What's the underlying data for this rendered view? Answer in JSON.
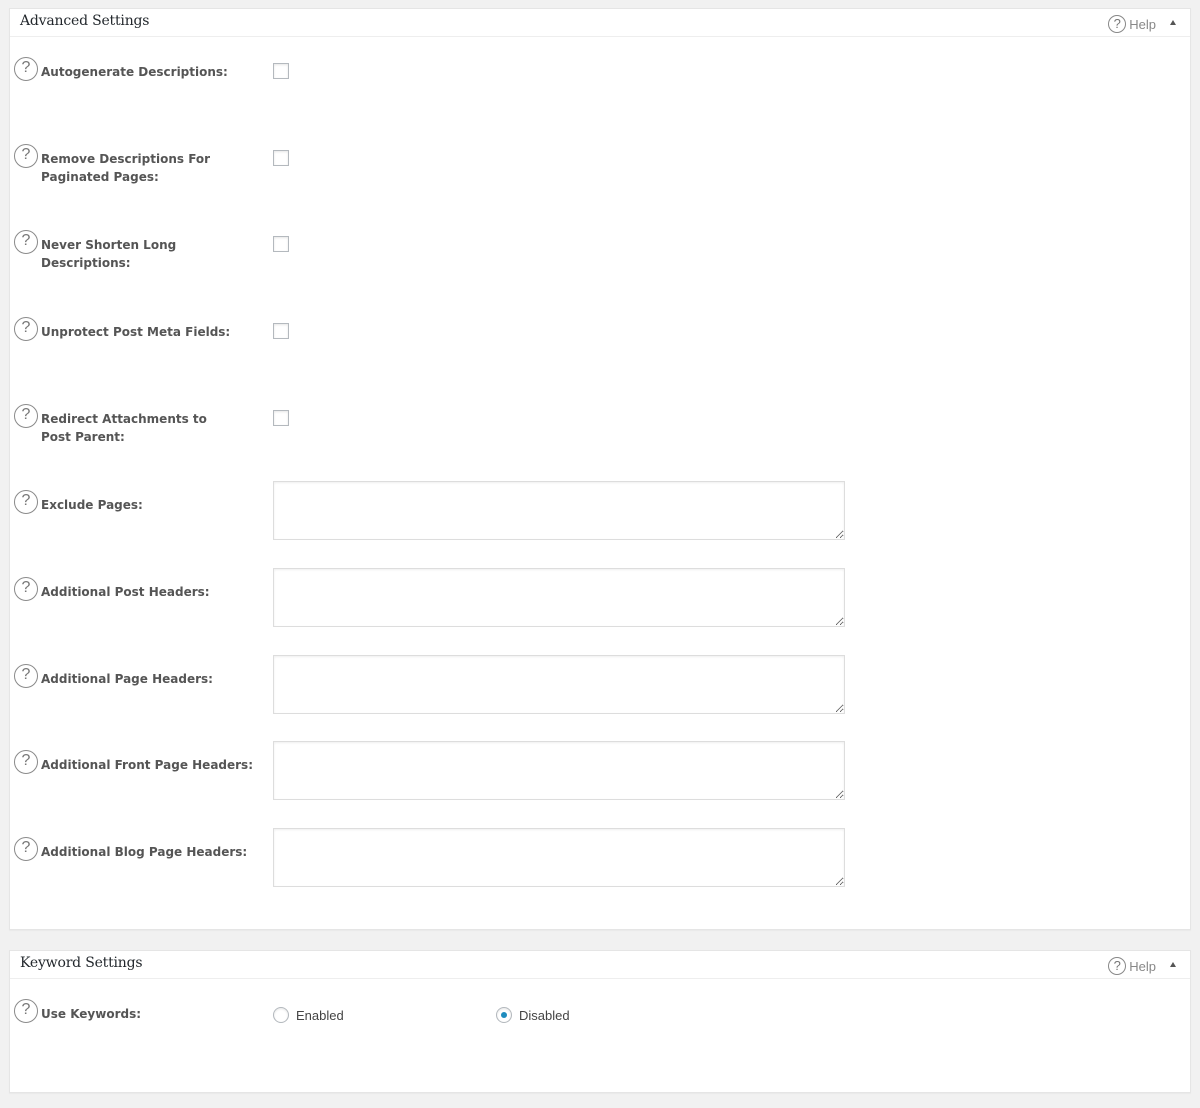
{
  "advanced": {
    "title": "Advanced Settings",
    "help_label": "Help",
    "checkbox_rows": [
      {
        "label": "Autogenerate Descriptions:",
        "checked": false
      },
      {
        "label": "Remove Descriptions For Paginated Pages:",
        "checked": false
      },
      {
        "label": "Never Shorten Long Descriptions:",
        "checked": false
      },
      {
        "label": "Unprotect Post Meta Fields:",
        "checked": false
      },
      {
        "label": "Redirect Attachments to Post Parent:",
        "checked": false
      }
    ],
    "textarea_rows": [
      {
        "label": "Exclude Pages:",
        "value": ""
      },
      {
        "label": "Additional Post Headers:",
        "value": ""
      },
      {
        "label": "Additional Page Headers:",
        "value": ""
      },
      {
        "label": "Additional Front Page Headers:",
        "value": ""
      },
      {
        "label": "Additional Blog Page Headers:",
        "value": ""
      }
    ]
  },
  "keyword": {
    "title": "Keyword Settings",
    "help_label": "Help",
    "use_keywords": {
      "label": "Use Keywords:",
      "options": [
        {
          "label": "Enabled",
          "checked": false
        },
        {
          "label": "Disabled",
          "checked": true
        }
      ]
    }
  },
  "help_icon_glyph": "?",
  "colors": {
    "background": "#f1f1f1",
    "panel": "#ffffff",
    "radio_accent": "#1e8cbe"
  }
}
